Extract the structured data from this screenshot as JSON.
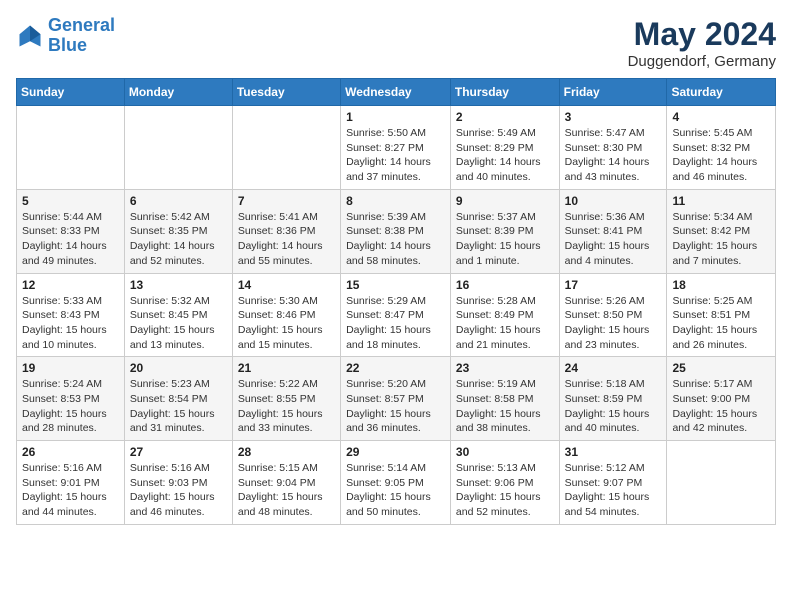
{
  "header": {
    "logo_line1": "General",
    "logo_line2": "Blue",
    "month_title": "May 2024",
    "location": "Duggendorf, Germany"
  },
  "weekdays": [
    "Sunday",
    "Monday",
    "Tuesday",
    "Wednesday",
    "Thursday",
    "Friday",
    "Saturday"
  ],
  "weeks": [
    [
      {
        "day": "",
        "sunrise": "",
        "sunset": "",
        "daylight": ""
      },
      {
        "day": "",
        "sunrise": "",
        "sunset": "",
        "daylight": ""
      },
      {
        "day": "",
        "sunrise": "",
        "sunset": "",
        "daylight": ""
      },
      {
        "day": "1",
        "sunrise": "Sunrise: 5:50 AM",
        "sunset": "Sunset: 8:27 PM",
        "daylight": "Daylight: 14 hours and 37 minutes."
      },
      {
        "day": "2",
        "sunrise": "Sunrise: 5:49 AM",
        "sunset": "Sunset: 8:29 PM",
        "daylight": "Daylight: 14 hours and 40 minutes."
      },
      {
        "day": "3",
        "sunrise": "Sunrise: 5:47 AM",
        "sunset": "Sunset: 8:30 PM",
        "daylight": "Daylight: 14 hours and 43 minutes."
      },
      {
        "day": "4",
        "sunrise": "Sunrise: 5:45 AM",
        "sunset": "Sunset: 8:32 PM",
        "daylight": "Daylight: 14 hours and 46 minutes."
      }
    ],
    [
      {
        "day": "5",
        "sunrise": "Sunrise: 5:44 AM",
        "sunset": "Sunset: 8:33 PM",
        "daylight": "Daylight: 14 hours and 49 minutes."
      },
      {
        "day": "6",
        "sunrise": "Sunrise: 5:42 AM",
        "sunset": "Sunset: 8:35 PM",
        "daylight": "Daylight: 14 hours and 52 minutes."
      },
      {
        "day": "7",
        "sunrise": "Sunrise: 5:41 AM",
        "sunset": "Sunset: 8:36 PM",
        "daylight": "Daylight: 14 hours and 55 minutes."
      },
      {
        "day": "8",
        "sunrise": "Sunrise: 5:39 AM",
        "sunset": "Sunset: 8:38 PM",
        "daylight": "Daylight: 14 hours and 58 minutes."
      },
      {
        "day": "9",
        "sunrise": "Sunrise: 5:37 AM",
        "sunset": "Sunset: 8:39 PM",
        "daylight": "Daylight: 15 hours and 1 minute."
      },
      {
        "day": "10",
        "sunrise": "Sunrise: 5:36 AM",
        "sunset": "Sunset: 8:41 PM",
        "daylight": "Daylight: 15 hours and 4 minutes."
      },
      {
        "day": "11",
        "sunrise": "Sunrise: 5:34 AM",
        "sunset": "Sunset: 8:42 PM",
        "daylight": "Daylight: 15 hours and 7 minutes."
      }
    ],
    [
      {
        "day": "12",
        "sunrise": "Sunrise: 5:33 AM",
        "sunset": "Sunset: 8:43 PM",
        "daylight": "Daylight: 15 hours and 10 minutes."
      },
      {
        "day": "13",
        "sunrise": "Sunrise: 5:32 AM",
        "sunset": "Sunset: 8:45 PM",
        "daylight": "Daylight: 15 hours and 13 minutes."
      },
      {
        "day": "14",
        "sunrise": "Sunrise: 5:30 AM",
        "sunset": "Sunset: 8:46 PM",
        "daylight": "Daylight: 15 hours and 15 minutes."
      },
      {
        "day": "15",
        "sunrise": "Sunrise: 5:29 AM",
        "sunset": "Sunset: 8:47 PM",
        "daylight": "Daylight: 15 hours and 18 minutes."
      },
      {
        "day": "16",
        "sunrise": "Sunrise: 5:28 AM",
        "sunset": "Sunset: 8:49 PM",
        "daylight": "Daylight: 15 hours and 21 minutes."
      },
      {
        "day": "17",
        "sunrise": "Sunrise: 5:26 AM",
        "sunset": "Sunset: 8:50 PM",
        "daylight": "Daylight: 15 hours and 23 minutes."
      },
      {
        "day": "18",
        "sunrise": "Sunrise: 5:25 AM",
        "sunset": "Sunset: 8:51 PM",
        "daylight": "Daylight: 15 hours and 26 minutes."
      }
    ],
    [
      {
        "day": "19",
        "sunrise": "Sunrise: 5:24 AM",
        "sunset": "Sunset: 8:53 PM",
        "daylight": "Daylight: 15 hours and 28 minutes."
      },
      {
        "day": "20",
        "sunrise": "Sunrise: 5:23 AM",
        "sunset": "Sunset: 8:54 PM",
        "daylight": "Daylight: 15 hours and 31 minutes."
      },
      {
        "day": "21",
        "sunrise": "Sunrise: 5:22 AM",
        "sunset": "Sunset: 8:55 PM",
        "daylight": "Daylight: 15 hours and 33 minutes."
      },
      {
        "day": "22",
        "sunrise": "Sunrise: 5:20 AM",
        "sunset": "Sunset: 8:57 PM",
        "daylight": "Daylight: 15 hours and 36 minutes."
      },
      {
        "day": "23",
        "sunrise": "Sunrise: 5:19 AM",
        "sunset": "Sunset: 8:58 PM",
        "daylight": "Daylight: 15 hours and 38 minutes."
      },
      {
        "day": "24",
        "sunrise": "Sunrise: 5:18 AM",
        "sunset": "Sunset: 8:59 PM",
        "daylight": "Daylight: 15 hours and 40 minutes."
      },
      {
        "day": "25",
        "sunrise": "Sunrise: 5:17 AM",
        "sunset": "Sunset: 9:00 PM",
        "daylight": "Daylight: 15 hours and 42 minutes."
      }
    ],
    [
      {
        "day": "26",
        "sunrise": "Sunrise: 5:16 AM",
        "sunset": "Sunset: 9:01 PM",
        "daylight": "Daylight: 15 hours and 44 minutes."
      },
      {
        "day": "27",
        "sunrise": "Sunrise: 5:16 AM",
        "sunset": "Sunset: 9:03 PM",
        "daylight": "Daylight: 15 hours and 46 minutes."
      },
      {
        "day": "28",
        "sunrise": "Sunrise: 5:15 AM",
        "sunset": "Sunset: 9:04 PM",
        "daylight": "Daylight: 15 hours and 48 minutes."
      },
      {
        "day": "29",
        "sunrise": "Sunrise: 5:14 AM",
        "sunset": "Sunset: 9:05 PM",
        "daylight": "Daylight: 15 hours and 50 minutes."
      },
      {
        "day": "30",
        "sunrise": "Sunrise: 5:13 AM",
        "sunset": "Sunset: 9:06 PM",
        "daylight": "Daylight: 15 hours and 52 minutes."
      },
      {
        "day": "31",
        "sunrise": "Sunrise: 5:12 AM",
        "sunset": "Sunset: 9:07 PM",
        "daylight": "Daylight: 15 hours and 54 minutes."
      },
      {
        "day": "",
        "sunrise": "",
        "sunset": "",
        "daylight": ""
      }
    ]
  ]
}
